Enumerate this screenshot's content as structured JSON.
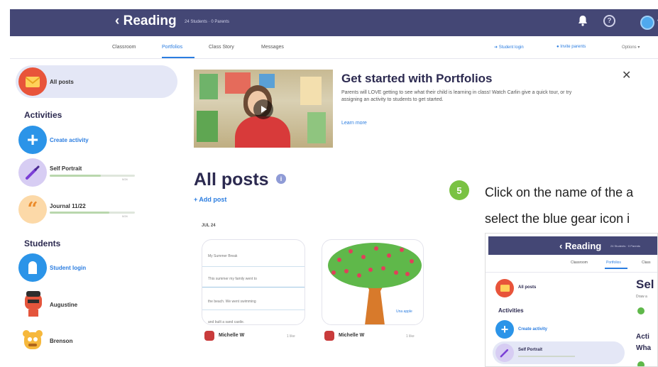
{
  "topbar": {
    "title": "‹ Reading",
    "subtitle": "24 Students · 0 Parents",
    "bell_icon": "bell-icon",
    "help_icon": "help-icon",
    "caret": "▾"
  },
  "nav": {
    "tabs": [
      {
        "label": "Classroom"
      },
      {
        "label": "Portfolios",
        "active": true
      },
      {
        "label": "Class Story"
      },
      {
        "label": "Messages"
      }
    ],
    "student_login": "Student login",
    "invite_parents": "Invite parents",
    "options": "Options ▾"
  },
  "sidebar": {
    "all_posts": "All posts",
    "activities_heading": "Activities",
    "create_activity": "Create activity",
    "activities": [
      {
        "label": "Self Portrait",
        "progress": 0.6,
        "meta": "0/24"
      },
      {
        "label": "Journal 11/22",
        "progress": 0.7,
        "meta": "0/24"
      }
    ],
    "students_heading": "Students",
    "student_login": "Student login",
    "students": [
      {
        "label": "Augustine"
      },
      {
        "label": "Brenson"
      }
    ]
  },
  "banner": {
    "title": "Get started with Portfolios",
    "text": "Parents will LOVE getting to see what their child is learning in class! Watch Carlin give a quick tour, or try assigning an activity to students to get started.",
    "link": "Learn more",
    "close": "✕"
  },
  "feed": {
    "title": "All posts",
    "info": "i",
    "add_post": "+ Add post",
    "date": "JUL 24",
    "cards": [
      {
        "lines": [
          "My Summer Break",
          "This summer my family went to",
          "the beach. We went swimming",
          "and built a sand castle."
        ],
        "author": "Michelle W",
        "meta": "1 like"
      },
      {
        "caption": "Una apple",
        "author": "Michelle W",
        "meta": "1 like"
      }
    ]
  },
  "tutorial": {
    "step": "5",
    "line1": "Click on the name of the a",
    "line2": "select the blue gear icon i"
  },
  "mini_screenshot": {
    "title": "‹ Reading",
    "subtitle": "24 Students · 0 Parents",
    "tabs": [
      "Classroom",
      "Portfolios",
      "Class"
    ],
    "all_posts": "All posts",
    "activities_heading": "Activities",
    "create_activity": "Create activity",
    "self_portrait": "Self Portrait",
    "right_title": "Sel",
    "right_sub": "Draw a",
    "right_heading1": "Acti",
    "right_heading2": "Wha"
  },
  "colors": {
    "topbar": "#444775",
    "accent": "#2b7de0",
    "pill": "#e4e7f6",
    "step": "#7ac243"
  }
}
